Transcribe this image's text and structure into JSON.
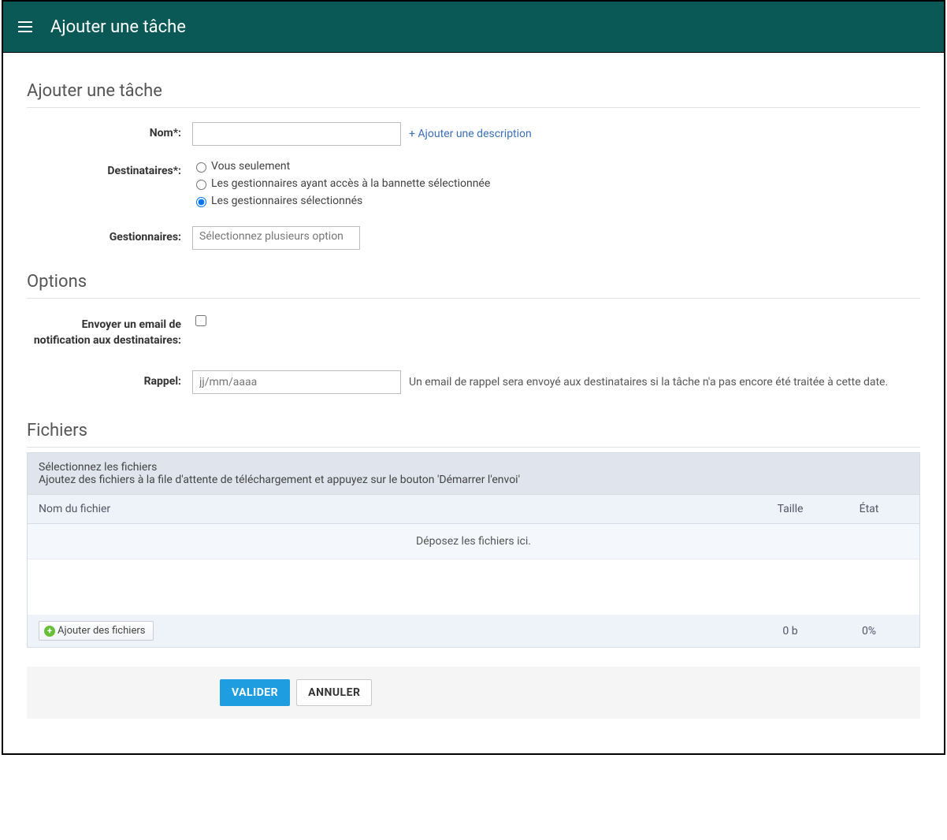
{
  "header": {
    "title": "Ajouter une tâche"
  },
  "sections": {
    "main_title": "Ajouter une tâche",
    "options_title": "Options",
    "files_title": "Fichiers"
  },
  "form": {
    "name_label": "Nom*:",
    "name_value": "",
    "add_description_link": "+ Ajouter une description",
    "recipients_label": "Destinataires*:",
    "recipients_options": {
      "you_only": "Vous seulement",
      "managers_access": "Les gestionnaires ayant accès à la bannette sélectionnée",
      "selected_managers": "Les gestionnaires sélectionnés"
    },
    "recipients_selected": "selected_managers",
    "managers_label": "Gestionnaires:",
    "managers_placeholder": "Sélectionnez plusieurs option",
    "email_notify_label": "Envoyer un email de notification aux destinataires:",
    "email_notify_checked": false,
    "reminder_label": "Rappel:",
    "reminder_placeholder": "jj/mm/aaaa",
    "reminder_value": "",
    "reminder_help": "Un email de rappel sera envoyé aux destinataires si la tâche n'a pas encore été traitée à cette date."
  },
  "files": {
    "header_line1": "Sélectionnez les fichiers",
    "header_line2": "Ajoutez des fichiers à la file d'attente de téléchargement et appuyez sur le bouton 'Démarrer l'envoi'",
    "col_name": "Nom du fichier",
    "col_size": "Taille",
    "col_status": "État",
    "drop_hint": "Déposez les fichiers ici.",
    "add_button": "Ajouter des fichiers",
    "total_size": "0 b",
    "total_percent": "0%"
  },
  "actions": {
    "submit": "VALIDER",
    "cancel": "ANNULER"
  }
}
